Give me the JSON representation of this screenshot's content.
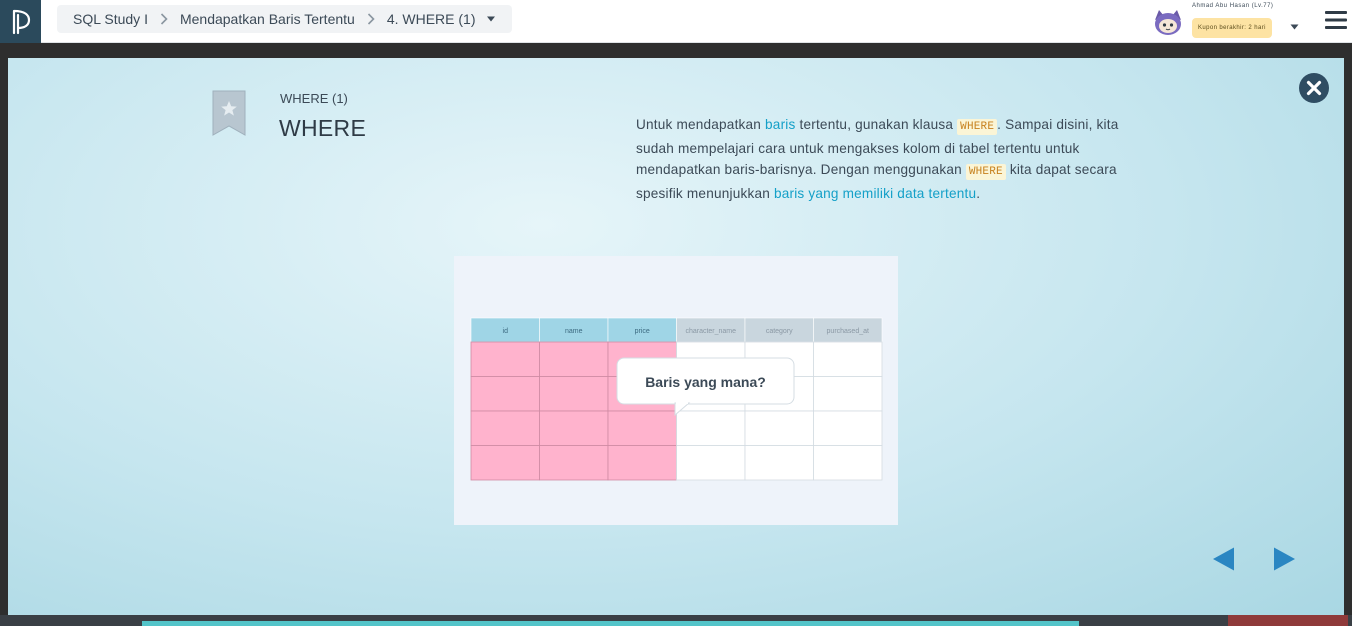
{
  "header": {
    "logo_icon": "progate-logo-icon",
    "breadcrumb": [
      {
        "label": "SQL Study I"
      },
      {
        "label": "Mendapatkan Baris Tertentu"
      },
      {
        "label": "4. WHERE (1)"
      }
    ],
    "user": {
      "name": "Ahmad Abu Hasan (Lv.77)",
      "coupon": "Kupon berakhir: 2 hari"
    },
    "menu_icon": "hamburger-menu-icon"
  },
  "slide": {
    "subtitle": "WHERE (1)",
    "title": "WHERE",
    "description": {
      "p1": "Untuk mendapatkan ",
      "h1": "baris",
      "p2": " tertentu, gunakan klausa ",
      "c1": "WHERE",
      "p3": ". Sampai disini, kita sudah mempelajari cara untuk mengakses kolom di tabel tertentu untuk mendapatkan baris-barisnya. Dengan menggunakan ",
      "c2": "WHERE",
      "p4": " kita dapat secara spesifik menunjukkan ",
      "h2": "baris yang memiliki data tertentu",
      "p5": "."
    },
    "illustration": {
      "columns": [
        "id",
        "name",
        "price",
        "character_name",
        "category",
        "purchased_at"
      ],
      "highlighted_columns": 3,
      "row_count": 4,
      "bubble_text": "Baris yang mana?"
    }
  },
  "colors": {
    "header_selected": "#9fd5e6",
    "header_unselected": "#c9d6de",
    "highlight_cell": "#ffb3cd",
    "link": "#14a0c8",
    "code": "#c7811e"
  }
}
